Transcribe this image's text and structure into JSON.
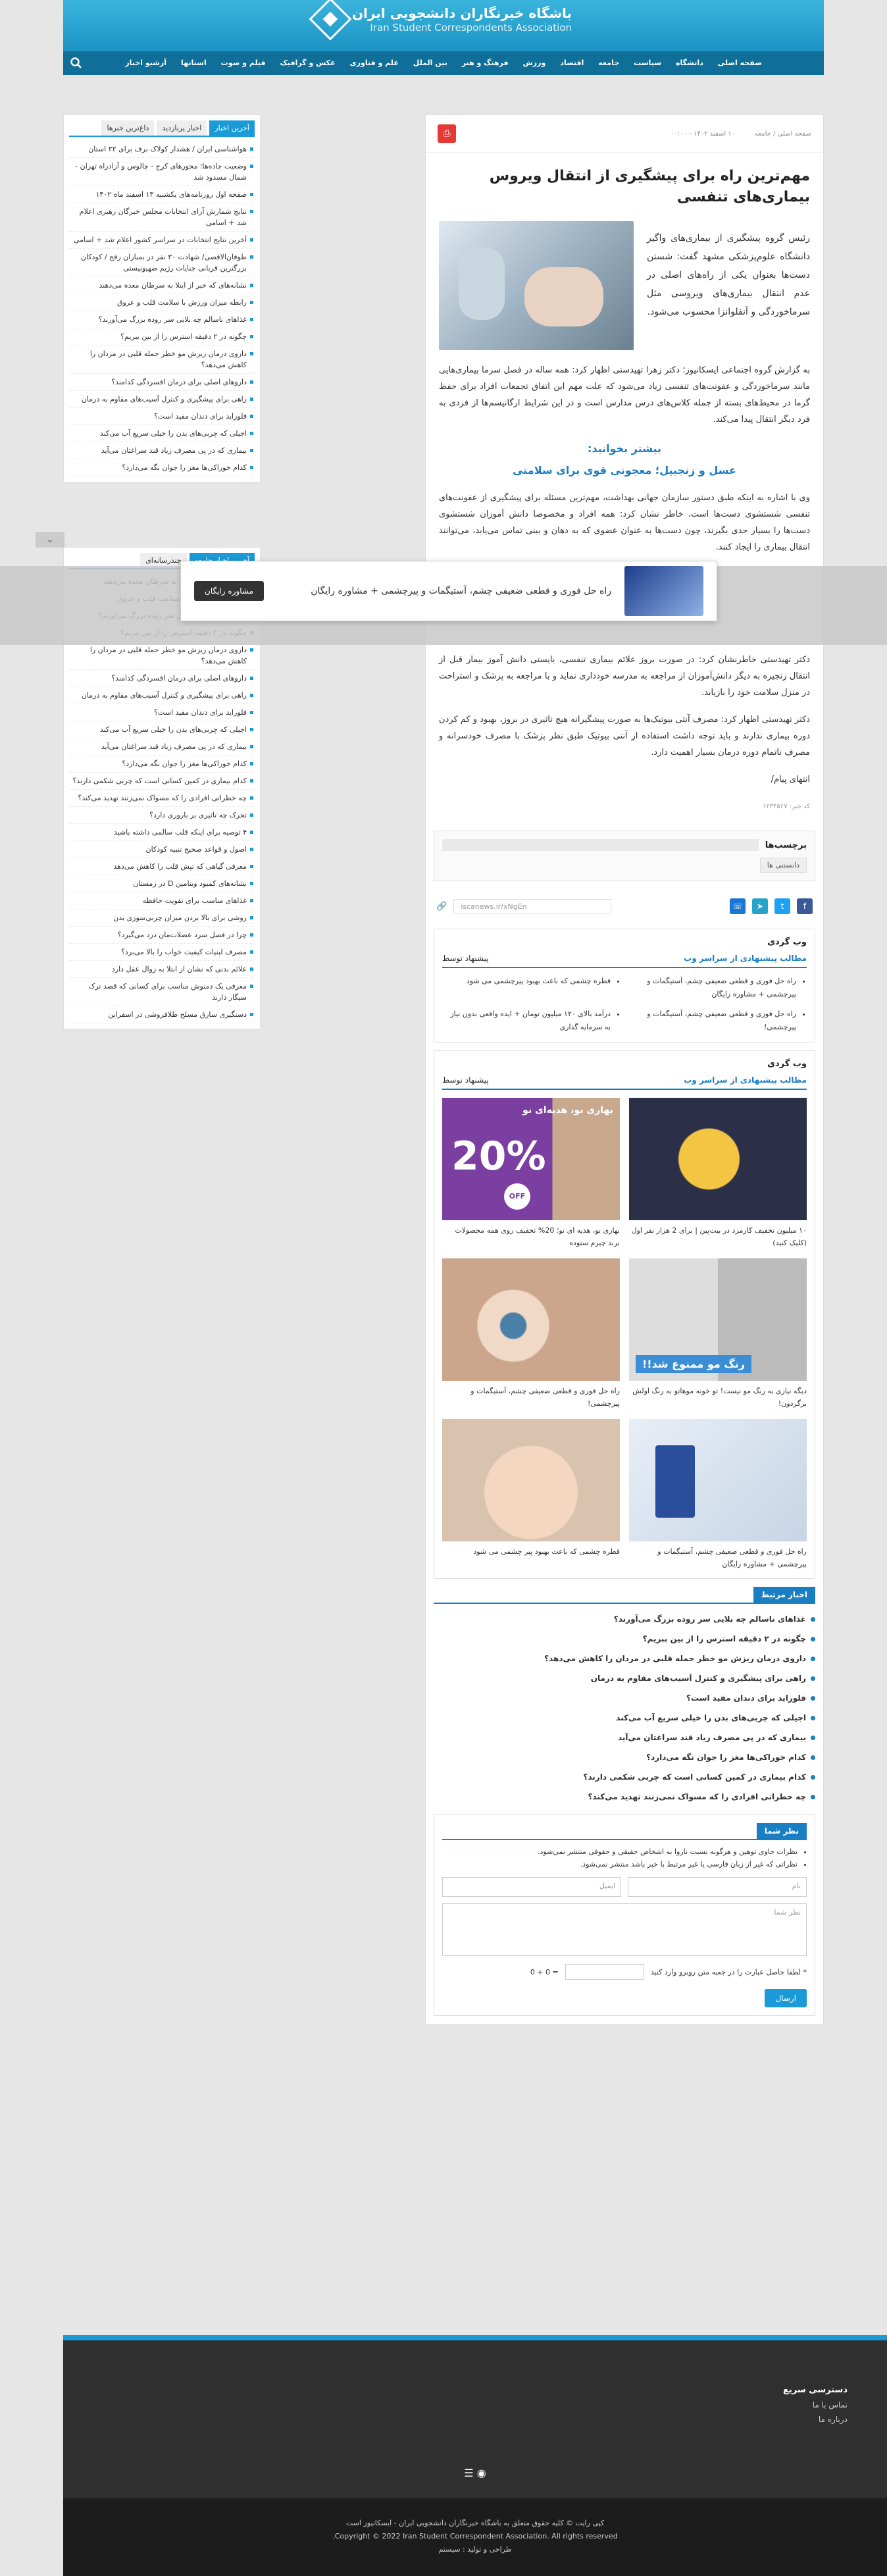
{
  "site": {
    "title_fa": "باشگاه خبرنگاران دانشجویی ایران",
    "title_en": "Iran Student Correspondents Association"
  },
  "nav": [
    "صفحه اصلی",
    "دانشگاه",
    "سیاست",
    "جامعه",
    "اقتصاد",
    "ورزش",
    "فرهنگ و هنر",
    "بین الملل",
    "علم و فناوری",
    "عکس و گرافیک",
    "فیلم و صوت",
    "استانها",
    "آرشیو اخبار"
  ],
  "article": {
    "crumb": "صفحه اصلی / جامعه",
    "date": "۱۰ اسفند ۱۴۰۲ - ۰۰:۰۰",
    "title": "مهم‌ترین راه برای پیشگیری از انتقال ویروس بیماری‌های تنفسی",
    "lead": "رئیس گروه پیشگیری از بیماری‌های واگیر دانشگاه علوم‌پزشکی مشهد گفت: شستن دست‌ها بعنوان یکی از راه‌های اصلی در عدم انتقال بیماری‌های ویروسی مثل سرماخوردگی و آنفلوانزا محسوب می‌شود.",
    "p1": "به گزارش گروه اجتماعی ایسکانیوز؛ دکتر زهرا تهیدستی اظهار کرد: همه ساله در فصل سرما بیماری‌هایی مانند سرماخوردگی و عفونت‌های تنفسی زیاد می‌شود که علت مهم این اتفاق تجمعات افراد برای حفظ گرما در محیط‌های بسته از جمله کلاس‌های درس مدارس است و در این شرایط ارگانیسم‌ها از فردی به فرد دیگر انتقال پیدا می‌کند.",
    "more_h": "بیشتر بخوانید:",
    "more_link": "عسل و زنجبیل؛ معجونی قوی برای سلامتی",
    "p2": "وی با اشاره به اینکه طبق دستور سازمان جهانی بهداشت، مهم‌ترین مسئله برای پیشگیری از عفونت‌های تنفسی شستشوی دست‌ها است، خاطر نشان کرد: همه افراد و مخصوصا دانش آموزان شستشوی دست‌ها را بسیار جدی بگیرند، چون دست‌ها به عنوان عضوی که به دهان و بینی تماس می‌یابد، می‌توانند انتقال بیماری را ایجاد کنند.",
    "p3": "دکتر تهیدستی خاطرنشان کرد: در صورت بروز علائم بیماری تنفسی، بایستی دانش آموز بیمار قبل از انتقال زنجیره به دیگر دانش‌آموزان از مراجعه به مدرسه خودداری نماید و با مراجعه به پزشک و استراحت در منزل سلامت خود را بازیابد.",
    "p4": "دکتر تهیدستی اظهار کرد: مصرف آنتی بیوتیک‌ها به صورت پیشگیرانه هیچ تاثیری در بروز، بهبود و کم کردن دوره بیماری ندارند و باید توجه داشت استفاده از آنتی بیوتیک طبق نظر پزشک با مصرف خودسرانه و مصرف ناتمام دوره درمان بسیار اهمیت دارد.",
    "end": "انتهای پیام/",
    "code": "کد خبر: ۱۲۳۴۵۶۷"
  },
  "tags": {
    "title": "برچسب‌ها",
    "items": [
      "دانستنی ها"
    ]
  },
  "short_url": "iscanews.ir/xNgEn",
  "webgardi1": {
    "title": "وب گردی",
    "sub": "مطالب پیشنهادی از سراسر وب",
    "by": "پیشنهاد توسط",
    "items": [
      "راه حل فوری و قطعی ضعیفی چشم، آستیگمات و پیرچشمی + مشاوره رایگان",
      "قطره چشمی که باعث بهبود پیرچشمی می شود",
      "راه حل فوری و قطعی ضعیفی چشم، آستیگمات و پیرچشمی!",
      "درآمد بالای ۱۲۰ میلیون تومان + ایده واقعی بدون نیاز به سرمایه گذاری"
    ]
  },
  "webgardi2": {
    "title": "وب گردی",
    "sub": "مطالب پیشنهادی از سراسر وب",
    "by": "پیشنهاد توسط",
    "ads": [
      "۱۰ میلیون تخفیف کارمزد در بیت‌پین | برای 2 هزار نفر اول (کلیک کنید)",
      "بهاری نو، هدیه ای نو؛ 20% تخفیف روی همه محصولات برند چیرم ستوده",
      "دیگه نیازی به رنگ مو نیست! تو خونه موهاتو به رنگ اولش برگردون!",
      "راه حل فوری و قطعی ضعیفی چشم، آستیگمات و پیرچشمی!",
      "راه حل فوری و قطعی ضعیفی چشم، آستیگمات و پیرچشمی + مشاوره رایگان",
      "قطره چشمی که باعث بهبود پیر چشمی می شود"
    ],
    "ad_badges": [
      "20%",
      "OFF",
      "بهاری نو، هدیه‌ای نو",
      "رنگ مو ممنوع شد!!"
    ]
  },
  "related": {
    "title": "اخبار مرتبط",
    "items": [
      "غذاهای ناسالم چه بلایی سر روده بزرگ می‌آورند؟",
      "چگونه در ۲ دقیقه استرس را از بین ببریم؟",
      "داروی درمان ریزش مو خطر حمله قلبی در مردان را کاهش می‌دهد؟",
      "راهی برای پیشگیری و کنترل آسیب‌های مقاوم به درمان",
      "فلوراید برای دندان مفید است؟",
      "اجیلی که چربی‌های بدن را خیلی سریع آب می‌کند",
      "بیماری که در پی مصرف زیاد قند سراغتان می‌آید",
      "کدام خوراکی‌ها مغز را جوان نگه می‌دارد؟",
      "کدام بیماری در کمین کسانی است که چربی شکمی دارند؟",
      "چه خطراتی افرادی را که مسواک نمی‌زنند تهدید می‌کند؟"
    ]
  },
  "comment": {
    "title": "نظر شما",
    "notes": [
      "نظرات حاوی توهین و هرگونه نسبت ناروا به اشخاص حقیقی و حقوقی منتشر نمی‌شود.",
      "نظراتی که غیر از زبان فارسی یا غیر مرتبط با خبر باشد منتشر نمی‌شود."
    ],
    "name_ph": "نام",
    "email_ph": "ایمیل",
    "text_ph": "نظر شما",
    "captcha_label": "* لطفا حاصل عبارت را در جعبه متن روبرو وارد کنید",
    "captcha_q": "0 + 0 =",
    "send": "ارسال"
  },
  "side1": {
    "tabs": [
      "آخرین اخبار",
      "اخبار پربازدید",
      "داغ‌ترین خبرها"
    ],
    "items": [
      "هواشناسی ایران / هشدار کولاک برف برای ۲۲ استان",
      "وضعیت جاده‌ها؛ محورهای کرج - چالوس و آزادراه تهران - شمال مسدود شد",
      "صفحه اول روزنامه‌های یکشنبه ۱۳ اسفند ماه ۱۴۰۲",
      "نتایج شمارش آرای انتخابات مجلس خبرگان رهبری اعلام شد + اسامی",
      "آخرین نتایج انتخابات در سراسر کشور اعلام شد + اسامی",
      "طوفان‌الاقصی/ شهادت ۳۰ نفر در بمباران رفح / کودکان بزرگترین قربانی جنایات رژیم صهیونیستی",
      "نشانه‌های که خبر از ابتلا به سرطان معده می‌دهند",
      "رابطه میزان ورزش با سلامت قلب و عروق",
      "غذاهای ناسالم چه بلایی سر روده بزرگ می‌آورند؟",
      "چگونه در ۲ دقیقه استرس را از بین ببریم؟",
      "داروی درمان ریزش مو خطر حمله قلبی در مردان را کاهش می‌دهد؟",
      "داروهای اصلی برای درمان افسردگی کدامند؟",
      "راهی برای پیشگیری و کنترل آسیب‌های مقاوم به درمان",
      "فلوراید برای دندان مفید است؟",
      "اجیلی که چربی‌های بدن را خیلی سریع آب می‌کند",
      "بیماری که در پی مصرف زیاد قند سراغتان می‌آید",
      "کدام خوراکی‌ها مغز را جوان نگه می‌دارد؟"
    ]
  },
  "side2": {
    "tabs": [
      "آخرین اخبار جامعه",
      "چندرسانه‌ای"
    ],
    "items": [
      "نشانه‌ای که خبر از ابتلا به سرطان معده می‌دهند",
      "رابطه میزان ورزش با سلامت قلب و عروق",
      "غذاهای ناسالم چه بلایی سر روده بزرگ می‌آورند؟",
      "چگونه در ۲ دقیقه استرس را از بین ببریم؟",
      "داروی درمان ریزش مو خطر حمله قلبی در مردان را کاهش می‌دهد؟",
      "داروهای اصلی برای درمان افسردگی کدامند؟",
      "راهی برای پیشگیری و کنترل آسیب‌های مقاوم به درمان",
      "فلوراید برای دندان مفید است؟",
      "اجیلی که چربی‌های بدن را خیلی سریع آب می‌کند",
      "بیماری که در پی مصرف زیاد قند سراغتان می‌آید",
      "کدام خوراکی‌ها مغز را جوان نگه می‌دارد؟",
      "کدام بیماری در کمین کسانی است که چربی شکمی دارند؟",
      "چه خطراتی افرادی را که مسواک نمی‌زنند تهدید می‌کند؟",
      "تحرک چه تاثیری بر باروری دارد؟",
      "۴ توصیه برای اینکه قلب سالمی داشته باشید",
      "اصول و قواعد صحیح تنبیه کودکان",
      "معرفی گیاهی که تپش قلب را کاهش می‌دهد",
      "نشانه‌های کمبود ویتامین D در زمستان",
      "غذاهای مناسب برای تقویت حافظه",
      "روشی برای بالا بردن میزان چربی‌سوزی بدن",
      "چرا در فصل سرد عضلات‌مان درد می‌گیرد؟",
      "مصرف لبنیات کیفیت خواب را بالا می‌برد؟",
      "علائم بدنی که نشان از ابتلا به زوال عقل دارد",
      "معرفی یک دمنوش مناسب برای کسانی که قصد ترک سیگار دارند",
      "دستگیری سارق مسلح طلافروشی در اسفراین"
    ]
  },
  "popup": {
    "text": "راه حل فوری و قطعی ضعیفی چشم، آستیگمات و پیرچشمی + مشاوره رایگان",
    "button": "مشاوره رایگان"
  },
  "footer": {
    "quick_title": "دسترسی سریع",
    "links": [
      "تماس با ما",
      "درباره ما"
    ],
    "copy1": "کپی رایت © کلیه حقوق متعلق به باشگاه خبرنگاران دانشجویی ایران - ایسکانیوز است",
    "copy2": "Copyright © 2022 Iran Student Correspondent Association. All rights reserved.",
    "credit": "طراحی و تولید : سیستم"
  },
  "colors": {
    "brand": "#1a9ad6",
    "nav_dark": "#0f6f98"
  }
}
